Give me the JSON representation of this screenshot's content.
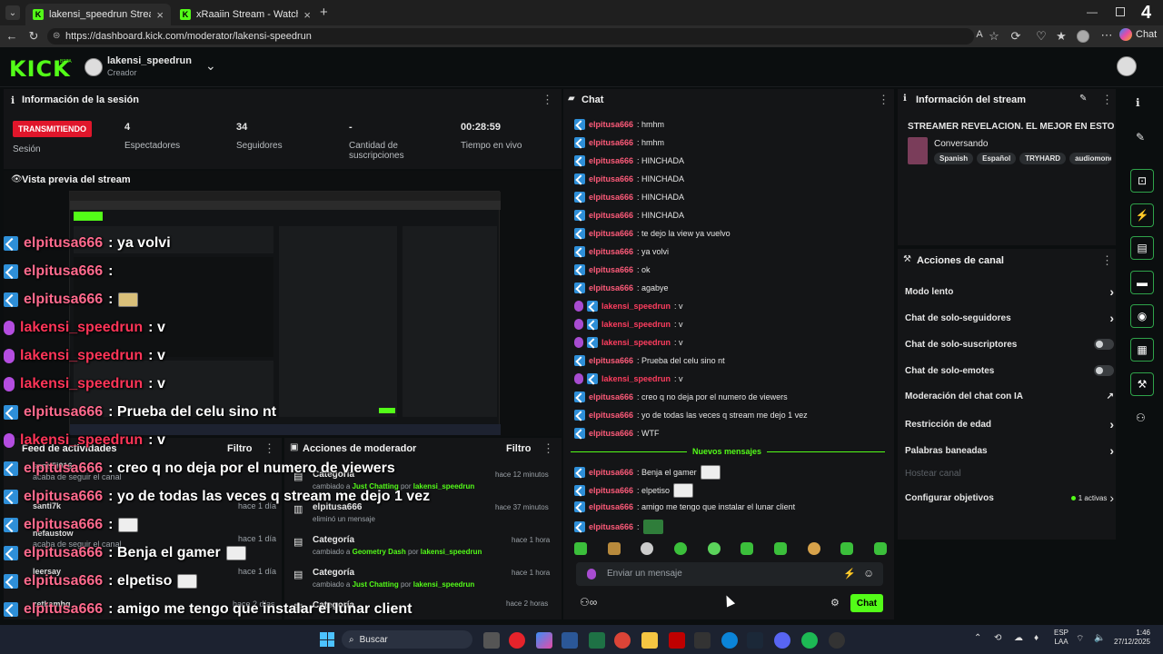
{
  "browser": {
    "tabs": [
      {
        "label": "lakensi_speedrun Stream - Kick Das"
      },
      {
        "label": "xRaaiin Stream - Watch Live on Kick"
      }
    ],
    "url": "https://dashboard.kick.com/moderator/lakensi-speedrun",
    "chat_button": "Chat",
    "tab_count": "4"
  },
  "header": {
    "logo": "KICK",
    "channel": "lakensi_speedrun",
    "role": "Creador"
  },
  "session": {
    "title": "Información de la sesión",
    "status_badge": "TRANSMITIENDO",
    "status_label": "Sesión",
    "stats": [
      {
        "value": "4",
        "label": "Espectadores"
      },
      {
        "value": "34",
        "label": "Seguidores"
      },
      {
        "value": "-",
        "label": "Cantidad de suscripciones"
      },
      {
        "value": "00:28:59",
        "label": "Tiempo en vivo"
      }
    ]
  },
  "preview": {
    "title": "Vista previa del stream"
  },
  "overlay_chat": [
    {
      "user": "elpitusa666",
      "text": ": ya volvi",
      "kind": "viewer"
    },
    {
      "user": "elpitusa666",
      "text": ":",
      "kind": "viewer"
    },
    {
      "user": "elpitusa666",
      "text": ":",
      "kind": "viewer"
    },
    {
      "user": "lakensi_speedrun",
      "text": ": v",
      "kind": "streamer"
    },
    {
      "user": "lakensi_speedrun",
      "text": ": v",
      "kind": "streamer"
    },
    {
      "user": "lakensi_speedrun",
      "text": ": v",
      "kind": "streamer"
    },
    {
      "user": "elpitusa666",
      "text": ": Prueba del celu sino nt",
      "kind": "viewer"
    },
    {
      "user": "lakensi_speedrun",
      "text": ": v",
      "kind": "streamer"
    },
    {
      "user": "elpitusa666",
      "text": ": creo q no deja por el numero de viewers",
      "kind": "viewer"
    },
    {
      "user": "elpitusa666",
      "text": ": yo de todas las veces q stream me dejo 1 vez",
      "kind": "viewer"
    },
    {
      "user": "elpitusa666",
      "text": ":",
      "kind": "viewer"
    },
    {
      "user": "elpitusa666",
      "text": ": Benja el gamer",
      "kind": "viewer"
    },
    {
      "user": "elpitusa666",
      "text": ": elpetiso",
      "kind": "viewer"
    },
    {
      "user": "elpitusa666",
      "text": ": amigo me tengo que instalar el lunar client",
      "kind": "viewer"
    },
    {
      "user": "elpitusa666",
      "text": ":",
      "kind": "viewer"
    }
  ],
  "activity": {
    "title": "Feed de actividades",
    "filter": "Filtro",
    "items": [
      {
        "name": "santi5i016",
        "text": "acaba de seguir el canal",
        "time": ""
      },
      {
        "name": "santi7k",
        "text": "",
        "time": "hace 1 día"
      },
      {
        "name": "nefaustow",
        "text": "acaba de seguir el canal",
        "time": "hace 1 día"
      },
      {
        "name": "leersay",
        "text": "",
        "time": "hace 1 día"
      },
      {
        "name": "zetkamhg",
        "text": "",
        "time": "hace 2 días"
      }
    ]
  },
  "modactions": {
    "title": "Acciones de moderador",
    "filter": "Filtro",
    "items": [
      {
        "title": "Categoría",
        "pre": "cambiado a",
        "target": "Just Chatting",
        "mid": "por",
        "by": "lakensi_speedrun",
        "time": "hace 12 minutos"
      },
      {
        "title": "elpitusa666",
        "pre": "eliminó un mensaje",
        "target": "",
        "mid": "",
        "by": "",
        "time": "hace 37 minutos"
      },
      {
        "title": "Categoría",
        "pre": "cambiado a",
        "target": "Geometry Dash",
        "mid": "por",
        "by": "lakensi_speedrun",
        "time": "hace 1 hora"
      },
      {
        "title": "Categoría",
        "pre": "cambiado a",
        "target": "Just Chatting",
        "mid": "por",
        "by": "lakensi_speedrun",
        "time": "hace 1 hora"
      },
      {
        "title": "Categoría",
        "pre": "",
        "target": "",
        "mid": "",
        "by": "",
        "time": "hace 2 horas"
      }
    ]
  },
  "chat": {
    "title": "Chat",
    "messages": [
      {
        "user": "elpitusa666",
        "text": ": hmhm",
        "kind": "viewer"
      },
      {
        "user": "elpitusa666",
        "text": ": hmhm",
        "kind": "viewer"
      },
      {
        "user": "elpitusa666",
        "text": ": HINCHADA",
        "kind": "viewer"
      },
      {
        "user": "elpitusa666",
        "text": ": HINCHADA",
        "kind": "viewer"
      },
      {
        "user": "elpitusa666",
        "text": ": HINCHADA",
        "kind": "viewer"
      },
      {
        "user": "elpitusa666",
        "text": ": HINCHADA",
        "kind": "viewer"
      },
      {
        "user": "elpitusa666",
        "text": ": te dejo la view ya vuelvo",
        "kind": "viewer"
      },
      {
        "user": "elpitusa666",
        "text": ": ya volvi",
        "kind": "viewer"
      },
      {
        "user": "elpitusa666",
        "text": ": ok",
        "kind": "viewer"
      },
      {
        "user": "elpitusa666",
        "text": ": agabye",
        "kind": "viewer"
      },
      {
        "user": "lakensi_speedrun",
        "text": ": v",
        "kind": "streamer"
      },
      {
        "user": "lakensi_speedrun",
        "text": ": v",
        "kind": "streamer"
      },
      {
        "user": "lakensi_speedrun",
        "text": ": v",
        "kind": "streamer"
      },
      {
        "user": "elpitusa666",
        "text": ": Prueba del celu sino nt",
        "kind": "viewer"
      },
      {
        "user": "lakensi_speedrun",
        "text": ": v",
        "kind": "streamer"
      },
      {
        "user": "elpitusa666",
        "text": ": creo q no deja por el numero de viewers",
        "kind": "viewer"
      },
      {
        "user": "elpitusa666",
        "text": ": yo de todas las veces q stream me dejo 1 vez",
        "kind": "viewer"
      },
      {
        "user": "elpitusa666",
        "text": ": WTF",
        "kind": "viewer"
      }
    ],
    "new_messages": "Nuevos mensajes",
    "new": [
      {
        "user": "elpitusa666",
        "text": ": Benja el gamer"
      },
      {
        "user": "elpitusa666",
        "text": ": elpetiso"
      },
      {
        "user": "elpitusa666",
        "text": ": amigo me tengo que instalar el lunar client"
      },
      {
        "user": "elpitusa666",
        "text": ":"
      }
    ],
    "input_placeholder": "Enviar un mensaje",
    "send_button": "Chat"
  },
  "stream_info": {
    "title": "Información del stream",
    "stream_title": "STREAMER REVELACION. EL MEJOR EN ESTO",
    "category": "Conversando",
    "tags": [
      "Spanish",
      "Español",
      "TRYHARD",
      "audiomonc"
    ]
  },
  "channel_actions": {
    "title": "Acciones de canal",
    "items": [
      {
        "label": "Modo lento",
        "control": "chevron"
      },
      {
        "label": "Chat de solo-seguidores",
        "control": "chevron"
      },
      {
        "label": "Chat de solo-suscriptores",
        "control": "toggle"
      },
      {
        "label": "Chat de solo-emotes",
        "control": "toggle"
      },
      {
        "label": "Moderación del chat con IA",
        "control": "external"
      },
      {
        "label": "Restricción de edad",
        "control": "chevron"
      },
      {
        "label": "Palabras baneadas",
        "control": "chevron"
      },
      {
        "label": "Hostear canal",
        "control": "disabled"
      },
      {
        "label": "Configurar objetivos",
        "control": "chevron",
        "extra": "1 activas"
      }
    ]
  },
  "taskbar": {
    "search": "Buscar",
    "lang_top": "ESP",
    "lang_bottom": "LAA",
    "time": "1:46",
    "date": "27/12/2025"
  },
  "colors": {
    "accent": "#53fc18",
    "live": "#e0162b",
    "username": "#ff5b7a",
    "badge": "#2e8fd8"
  }
}
